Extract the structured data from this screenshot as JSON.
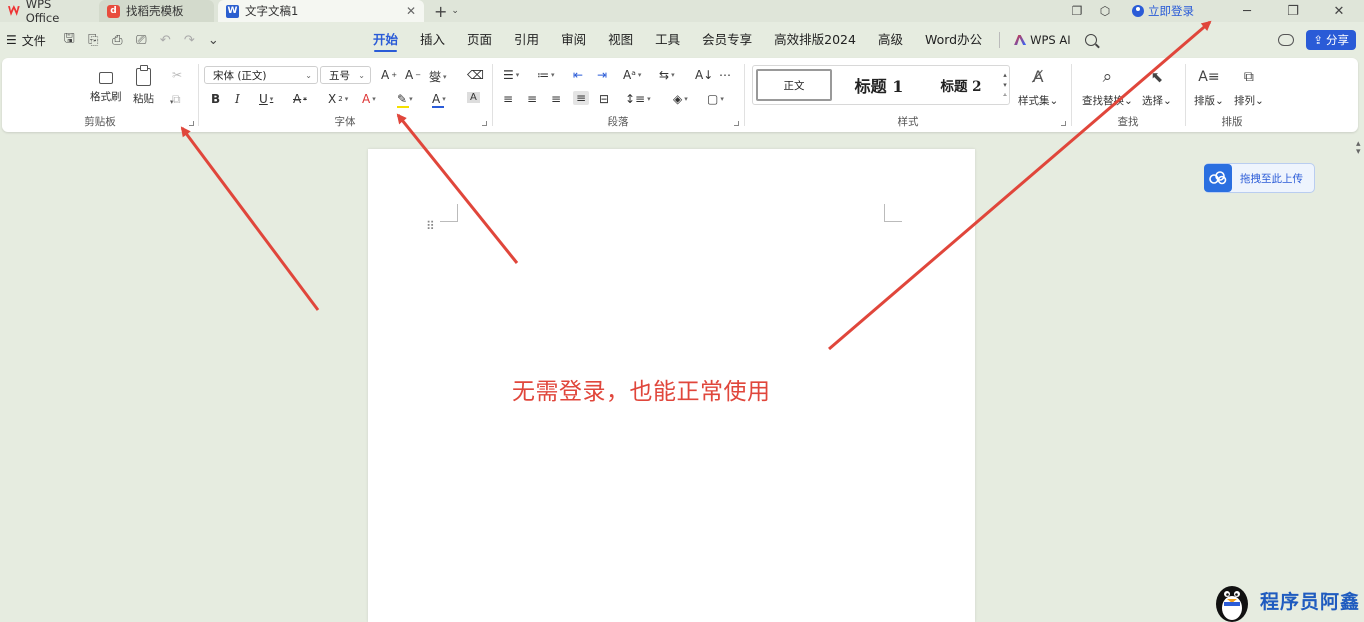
{
  "tabs": [
    {
      "label": "WPS Office"
    },
    {
      "label": "找稻壳模板"
    },
    {
      "label": "文字文稿1"
    }
  ],
  "titlebar": {
    "login_label": "立即登录"
  },
  "menubar": {
    "file_label": "文件",
    "menus": [
      "开始",
      "插入",
      "页面",
      "引用",
      "审阅",
      "视图",
      "工具",
      "会员专享",
      "高效排版2024",
      "高级",
      "Word办公"
    ],
    "active_menu": "开始",
    "wps_ai_label": "WPS AI",
    "share_label": "分享"
  },
  "ribbon": {
    "clipboard": {
      "label": "剪贴板",
      "format_painter": "格式刷",
      "paste": "粘贴"
    },
    "font": {
      "label": "字体",
      "font_name": "宋体 (正文)",
      "font_size": "五号"
    },
    "paragraph": {
      "label": "段落"
    },
    "styles": {
      "label": "样式",
      "normal": "正文",
      "heading1": "标题 1",
      "heading2": "标题 2",
      "style_set": "样式集"
    },
    "find": {
      "label": "查找",
      "find_replace": "查找替换",
      "select": "选择"
    },
    "arrange": {
      "label": "排版",
      "layout": "排版",
      "arrange": "排列"
    }
  },
  "document": {
    "upload_label": "拖拽至此上传"
  },
  "annotation": {
    "text": "无需登录，也能正常使用"
  },
  "watermark": {
    "text": "程序员阿鑫"
  },
  "colors": {
    "accent": "#2a5bd7",
    "annotation_red": "#e0463b",
    "background": "#e6ece0"
  }
}
